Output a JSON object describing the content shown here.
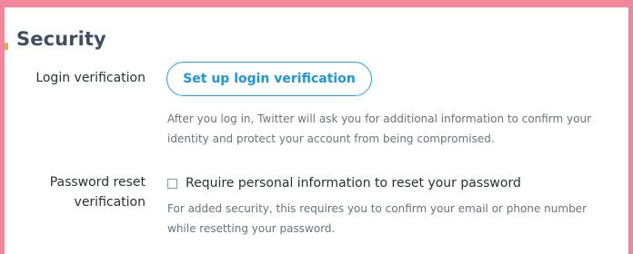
{
  "security": {
    "title": "Security",
    "login_verification": {
      "label": "Login verification",
      "button_label": "Set up login verification",
      "helper_text": "After you log in, Twitter will ask you for additional information to confirm your identity and protect your account from being compromised."
    },
    "password_reset": {
      "label": "Password reset verification",
      "checkbox_label": "Require personal information to reset your password",
      "checkbox_checked": false,
      "helper_text": "For added security, this requires you to confirm your email or phone number while resetting your password."
    }
  },
  "colors": {
    "background_frame": "#f2879b",
    "panel": "#ffffff",
    "accent": "#1da1f2",
    "heading": "#3e4f5f",
    "text": "#292f33",
    "muted_text": "#66757f"
  }
}
